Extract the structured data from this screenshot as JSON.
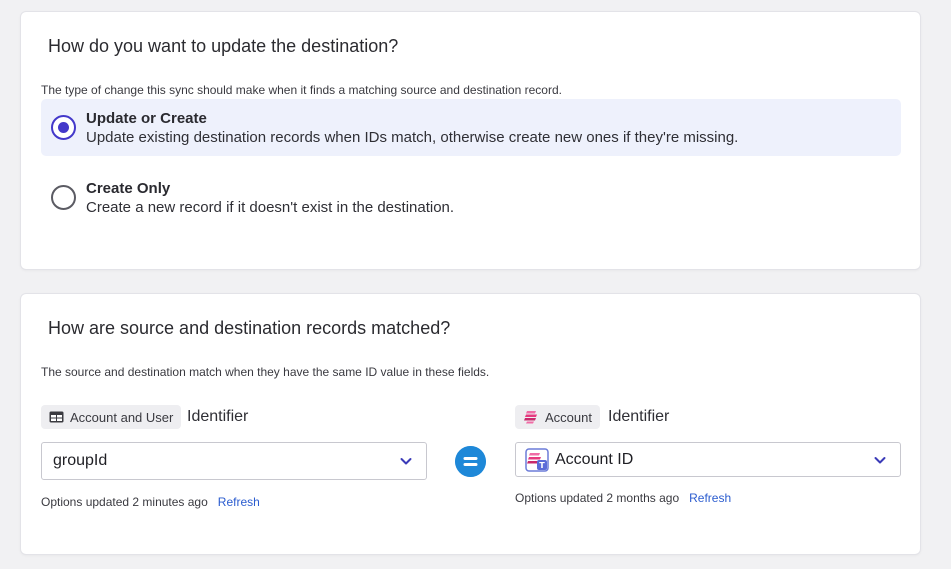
{
  "update_section": {
    "title": "How do you want to update the destination?",
    "description": "The type of change this sync should make when it finds a matching source and destination record.",
    "options": [
      {
        "title": "Update or Create",
        "text": "Update existing destination records when IDs match, otherwise create new ones if they're missing.",
        "selected": true
      },
      {
        "title": "Create Only",
        "text": "Create a new record if it doesn't exist in the destination.",
        "selected": false
      }
    ]
  },
  "match_section": {
    "title": "How are source and destination records matched?",
    "description": "The source and destination match when they have the same ID value in these fields.",
    "source": {
      "tag_label": "Account and User",
      "tag_icon": "table-icon",
      "field_label": "Identifier",
      "selected_value": "groupId",
      "updated_text": "Options updated 2 minutes ago",
      "refresh_label": "Refresh"
    },
    "equals_icon": "equals-icon",
    "destination": {
      "tag_label": "Account",
      "tag_icon": "destination-logo-icon",
      "field_label": "Identifier",
      "selected_value": "Account ID",
      "value_icon": "text-field-icon",
      "updated_text": "Options updated 2 months ago",
      "refresh_label": "Refresh"
    }
  },
  "colors": {
    "accent": "#4338ca",
    "selected_bg": "#eef1fc",
    "equals": "#1e88d8",
    "link": "#2b5ccf",
    "brand_pink": "#e6397f"
  }
}
